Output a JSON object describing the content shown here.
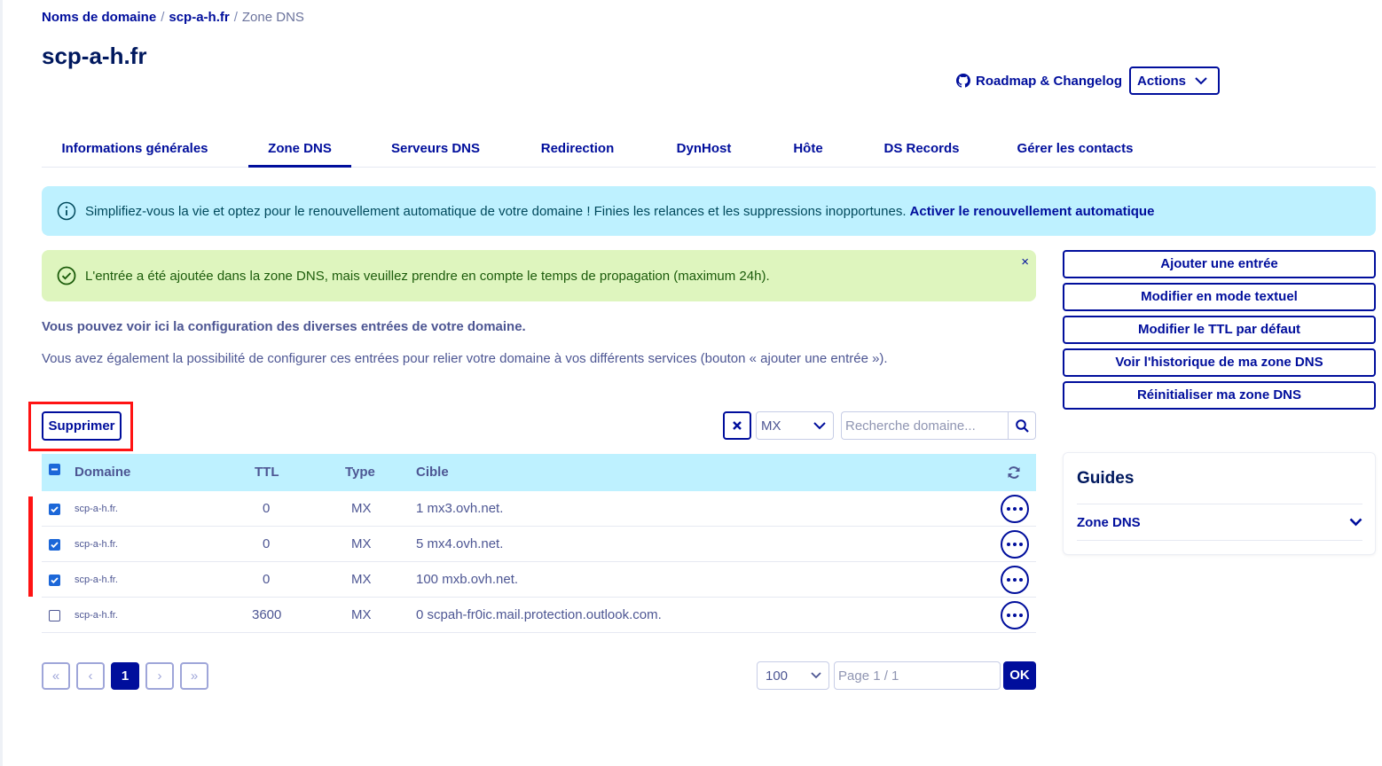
{
  "breadcrumb": {
    "items": [
      "Noms de domaine",
      "scp-a-h.fr"
    ],
    "current": "Zone DNS",
    "separator": "/"
  },
  "page_title": "scp-a-h.fr",
  "top_actions": {
    "roadmap_label": "Roadmap & Changelog",
    "actions_label": "Actions"
  },
  "tabs": [
    {
      "label": "Informations générales",
      "active": false
    },
    {
      "label": "Zone DNS",
      "active": true
    },
    {
      "label": "Serveurs DNS",
      "active": false
    },
    {
      "label": "Redirection",
      "active": false
    },
    {
      "label": "DynHost",
      "active": false
    },
    {
      "label": "Hôte",
      "active": false
    },
    {
      "label": "DS Records",
      "active": false
    },
    {
      "label": "Gérer les contacts",
      "active": false
    }
  ],
  "info_banner": {
    "text": "Simplifiez-vous la vie et optez pour le renouvellement automatique de votre domaine ! Finies les relances et les suppressions inopportunes.",
    "link": "Activer le renouvellement automatique"
  },
  "success_banner": {
    "text": "L'entrée a été ajoutée dans la zone DNS, mais veuillez prendre en compte le temps de propagation (maximum 24h).",
    "close": "×"
  },
  "description": {
    "bold": "Vous pouvez voir ici la configuration des diverses entrées de votre domaine.",
    "text": "Vous avez également la possibilité de configurer ces entrées pour relier votre domaine à vos différents services (bouton « ajouter une entrée »)."
  },
  "side_buttons": [
    "Ajouter une entrée",
    "Modifier en mode textuel",
    "Modifier le TTL par défaut",
    "Voir l'historique de ma zone DNS",
    "Réinitialiser ma zone DNS"
  ],
  "toolbar": {
    "delete_label": "Supprimer",
    "filter_value": "MX",
    "search_placeholder": "Recherche domaine..."
  },
  "table": {
    "headers": {
      "domain": "Domaine",
      "ttl": "TTL",
      "type": "Type",
      "target": "Cible"
    },
    "rows": [
      {
        "checked": true,
        "domain": "scp-a-h.fr.",
        "ttl": "0",
        "type": "MX",
        "target": "1 mx3.ovh.net."
      },
      {
        "checked": true,
        "domain": "scp-a-h.fr.",
        "ttl": "0",
        "type": "MX",
        "target": "5 mx4.ovh.net."
      },
      {
        "checked": true,
        "domain": "scp-a-h.fr.",
        "ttl": "0",
        "type": "MX",
        "target": "100 mxb.ovh.net."
      },
      {
        "checked": false,
        "domain": "scp-a-h.fr.",
        "ttl": "3600",
        "type": "MX",
        "target": "0 scpah-fr0ic.mail.protection.outlook.com."
      }
    ]
  },
  "pagination": {
    "first": "«",
    "prev": "‹",
    "current": "1",
    "next": "›",
    "last": "»",
    "per_page": "100",
    "page_placeholder": "Page 1 / 1",
    "ok_label": "OK"
  },
  "guides": {
    "title": "Guides",
    "item": "Zone DNS"
  },
  "colors": {
    "primary": "#000e9c",
    "info_bg": "#bef1ff",
    "success_bg": "#def5be",
    "highlight_red": "#ff1313",
    "checkbox_blue": "#1c67d8"
  }
}
